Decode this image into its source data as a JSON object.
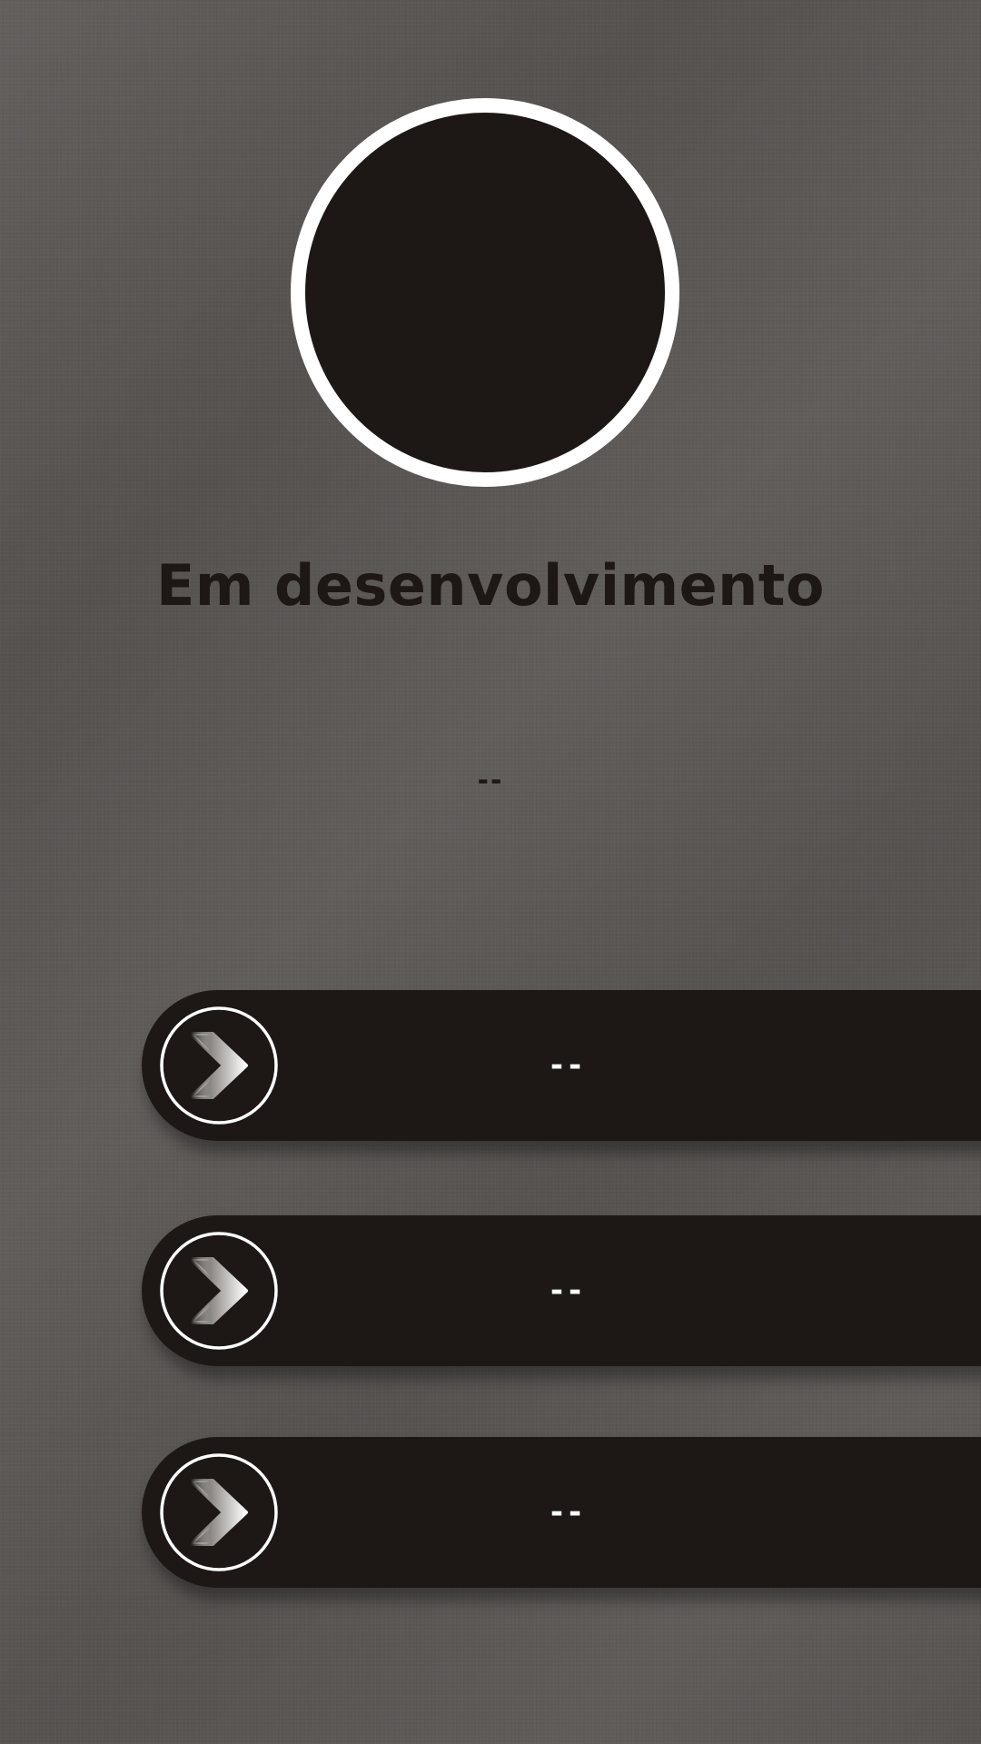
{
  "profile": {
    "avatar_icon": "avatar-placeholder"
  },
  "status": {
    "title": "Em desenvolvimento",
    "subtitle": "--"
  },
  "buttons": [
    {
      "label": "--",
      "icon": "chevron-right-icon"
    },
    {
      "label": "--",
      "icon": "chevron-right-icon"
    },
    {
      "label": "--",
      "icon": "chevron-right-icon"
    }
  ],
  "colors": {
    "background": "#5a5654",
    "button": "#1d1815",
    "text_dark": "#1d1815",
    "text_light": "#ffffff",
    "ring": "#ffffff"
  }
}
